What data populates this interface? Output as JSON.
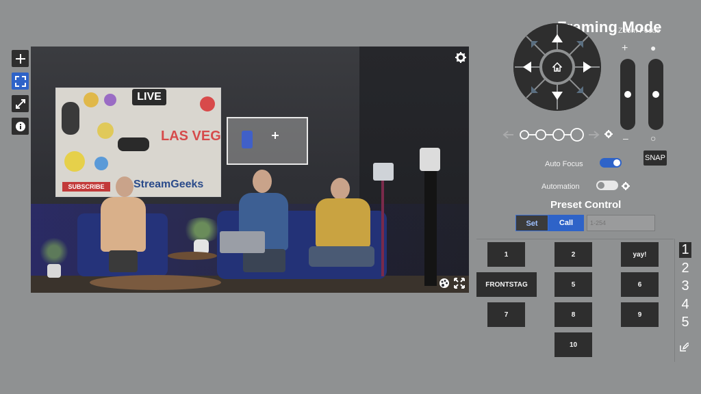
{
  "framing_mode": {
    "title": "Framing Mode",
    "zoom_focus_label": "Zoom   Focus",
    "zoom_plus": "+",
    "zoom_minus": "–",
    "focus_filled": "●",
    "focus_empty": "○"
  },
  "toolbar": {
    "tools": [
      "add-tool",
      "frame-tool",
      "resize-tool",
      "info-tool"
    ],
    "active": "frame-tool"
  },
  "controls": {
    "auto_focus_label": "Auto Focus",
    "auto_focus_on": true,
    "automation_label": "Automation",
    "automation_on": false,
    "snap_label": "SNAP"
  },
  "preset_control": {
    "title": "Preset Control",
    "set_label": "Set",
    "call_label": "Call",
    "input_placeholder": "1-254",
    "presets": [
      "1",
      "2",
      "yay!",
      "FRONTSTAG",
      "5",
      "6",
      "7",
      "8",
      "9",
      "10"
    ],
    "pages": [
      "1",
      "2",
      "3",
      "4",
      "5"
    ],
    "selected_page": "1"
  },
  "video": {
    "poster_live": "LIVE",
    "poster_subscribe": "SUBSCRIBE",
    "poster_brand": "StreamGeeks",
    "poster_vegas": "LAS VEG"
  },
  "colors": {
    "accent": "#2e63c8",
    "button_dark": "#2e2e2e",
    "background": "#8f9192"
  }
}
